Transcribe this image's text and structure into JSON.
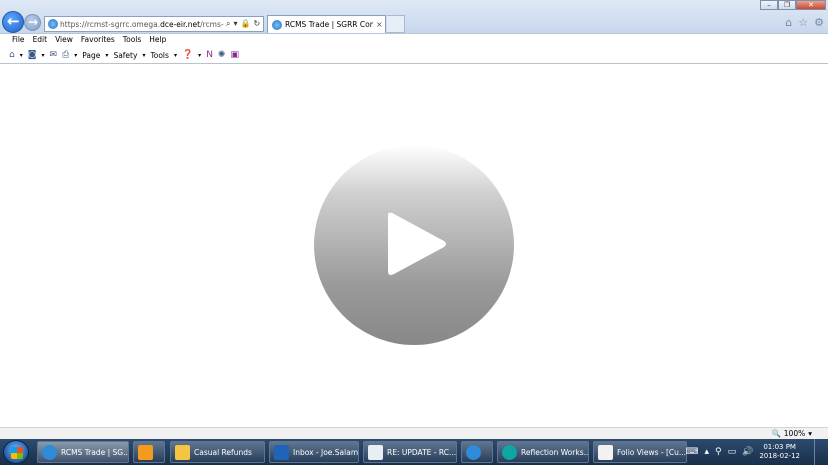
{
  "browser": {
    "url_prefix": "https://rcmst-sgrrc.omega.",
    "url_domain": "dce-eir.net",
    "url_suffix": "/rcms-trade-",
    "tab_title": "RCMS Trade | SGRR Comm...",
    "tab_close": "×",
    "window": {
      "minimize": "–",
      "restore": "❐",
      "close": "✕"
    }
  },
  "menu": [
    "File",
    "Edit",
    "View",
    "Favorites",
    "Tools",
    "Help"
  ],
  "command_bar": {
    "page_label": "Page",
    "safety_label": "Safety",
    "tools_label": "Tools"
  },
  "status": {
    "zoom": "100%"
  },
  "taskbar": {
    "items": [
      {
        "label": "RCMS Trade | SG...",
        "color": "#2e8bd8"
      },
      {
        "label": "",
        "color": "#f39b1f"
      },
      {
        "label": "Casual Refunds",
        "color": "#f4c542"
      },
      {
        "label": "Inbox - Joe.Salam...",
        "color": "#1f64b8"
      },
      {
        "label": "RE: UPDATE - RC...",
        "color": "#e9eef4"
      },
      {
        "label": "",
        "color": "#2e8bd8"
      },
      {
        "label": "Reflection Works...",
        "color": "#0fa5a0"
      },
      {
        "label": "Folio Views - [Cu...",
        "color": "#f2f2f2"
      }
    ],
    "clock_time": "01:03 PM",
    "clock_date": "2018-02-12"
  }
}
